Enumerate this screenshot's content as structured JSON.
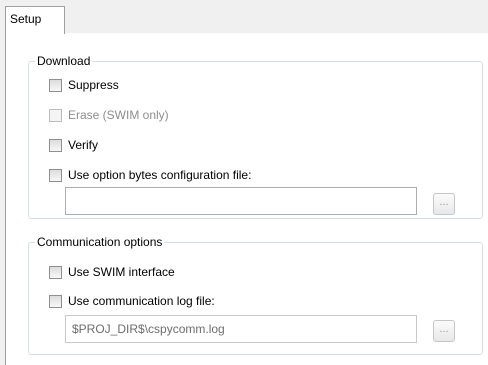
{
  "tabs": [
    {
      "label": "Setup"
    }
  ],
  "download": {
    "title": "Download",
    "suppress": {
      "label": "Suppress",
      "checked": false,
      "enabled": true
    },
    "erase": {
      "label": "Erase (SWIM only)",
      "checked": false,
      "enabled": false
    },
    "verify": {
      "label": "Verify",
      "checked": false,
      "enabled": true
    },
    "option_bytes": {
      "label": "Use option bytes configuration file:",
      "checked": false,
      "enabled": true
    },
    "option_bytes_path": "",
    "browse_label": "..."
  },
  "communication": {
    "title": "Communication options",
    "swim": {
      "label": "Use SWIM interface",
      "checked": false,
      "enabled": true
    },
    "log_file": {
      "label": "Use communication log file:",
      "checked": false,
      "enabled": true
    },
    "log_file_path": "$PROJ_DIR$\\cspycomm.log",
    "browse_label": "..."
  }
}
